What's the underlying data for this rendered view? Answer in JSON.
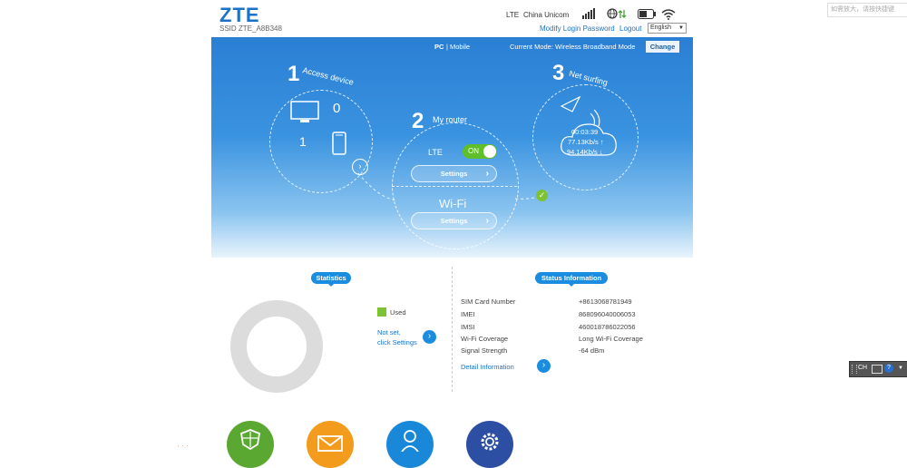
{
  "header": {
    "logo": "ZTE",
    "ssid": "SSID ZTE_A8B348",
    "network_type": "LTE",
    "carrier": "China Unicom",
    "modify_password": "Modify Login Password",
    "logout": "Logout",
    "language": "English"
  },
  "mode_bar": {
    "pc": "PC",
    "separator": "|",
    "mobile": "Mobile",
    "current_mode": "Current Mode: Wireless Broadband Mode",
    "change": "Change"
  },
  "steps": {
    "access": {
      "num": "1",
      "label": "Access device",
      "wifi_count": "0",
      "usb_count": "1"
    },
    "router": {
      "num": "2",
      "label": "My router",
      "lte_label": "LTE",
      "toggle_label": "ON",
      "lte_settings": "Settings",
      "wifi_label": "Wi-Fi",
      "wifi_settings": "Settings"
    },
    "net": {
      "num": "3",
      "label": "Net surfing",
      "duration": "00:03:39",
      "upload": "77.13Kb/s ↑",
      "download": "94.14Kb/s ↓"
    }
  },
  "statistics": {
    "title": "Statistics",
    "legend_used": "Used",
    "not_set_line1": "Not set,",
    "not_set_line2": "click Settings"
  },
  "status": {
    "title": "Status Information",
    "rows": [
      {
        "label": "SIM Card Number",
        "value": "+8613068781949"
      },
      {
        "label": "IMEI",
        "value": "868096040006053"
      },
      {
        "label": "IMSI",
        "value": "460018786022056"
      },
      {
        "label": "Wi-Fi Coverage",
        "value": "Long Wi-Fi Coverage"
      },
      {
        "label": "Signal Strength",
        "value": "-64 dBm"
      }
    ],
    "detail_link": "Detail Information"
  },
  "side": {
    "hint": "如需放大，请按快捷键",
    "toolbar": "CH"
  },
  "colors": {
    "brand": "#1a73c8",
    "hero_top": "#2a7fd4",
    "toggle_on": "#5fbf2a",
    "used": "#7cc233",
    "icon_green": "#5aa832",
    "icon_orange": "#f29b1d",
    "icon_blue": "#1a88d8",
    "icon_navy": "#2d4fa3"
  },
  "bottom_icons": [
    "firewall-icon",
    "sms-icon",
    "user-icon",
    "settings-icon"
  ]
}
